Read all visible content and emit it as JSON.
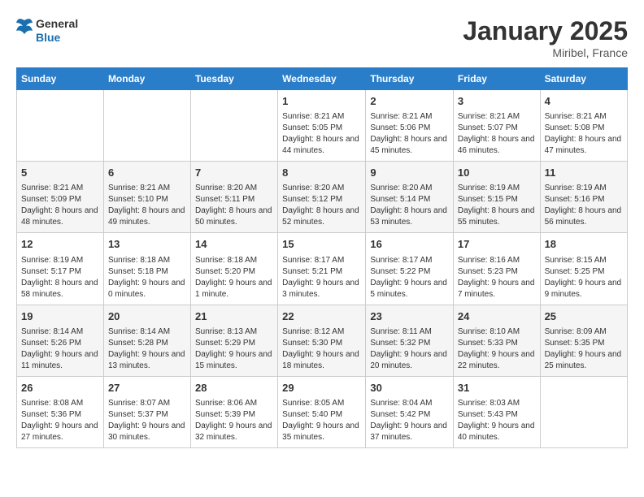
{
  "logo": {
    "line1": "General",
    "line2": "Blue"
  },
  "title": "January 2025",
  "location": "Miribel, France",
  "days_of_week": [
    "Sunday",
    "Monday",
    "Tuesday",
    "Wednesday",
    "Thursday",
    "Friday",
    "Saturday"
  ],
  "weeks": [
    [
      {
        "day": "",
        "sunrise": "",
        "sunset": "",
        "daylight": ""
      },
      {
        "day": "",
        "sunrise": "",
        "sunset": "",
        "daylight": ""
      },
      {
        "day": "",
        "sunrise": "",
        "sunset": "",
        "daylight": ""
      },
      {
        "day": "1",
        "sunrise": "Sunrise: 8:21 AM",
        "sunset": "Sunset: 5:05 PM",
        "daylight": "Daylight: 8 hours and 44 minutes."
      },
      {
        "day": "2",
        "sunrise": "Sunrise: 8:21 AM",
        "sunset": "Sunset: 5:06 PM",
        "daylight": "Daylight: 8 hours and 45 minutes."
      },
      {
        "day": "3",
        "sunrise": "Sunrise: 8:21 AM",
        "sunset": "Sunset: 5:07 PM",
        "daylight": "Daylight: 8 hours and 46 minutes."
      },
      {
        "day": "4",
        "sunrise": "Sunrise: 8:21 AM",
        "sunset": "Sunset: 5:08 PM",
        "daylight": "Daylight: 8 hours and 47 minutes."
      }
    ],
    [
      {
        "day": "5",
        "sunrise": "Sunrise: 8:21 AM",
        "sunset": "Sunset: 5:09 PM",
        "daylight": "Daylight: 8 hours and 48 minutes."
      },
      {
        "day": "6",
        "sunrise": "Sunrise: 8:21 AM",
        "sunset": "Sunset: 5:10 PM",
        "daylight": "Daylight: 8 hours and 49 minutes."
      },
      {
        "day": "7",
        "sunrise": "Sunrise: 8:20 AM",
        "sunset": "Sunset: 5:11 PM",
        "daylight": "Daylight: 8 hours and 50 minutes."
      },
      {
        "day": "8",
        "sunrise": "Sunrise: 8:20 AM",
        "sunset": "Sunset: 5:12 PM",
        "daylight": "Daylight: 8 hours and 52 minutes."
      },
      {
        "day": "9",
        "sunrise": "Sunrise: 8:20 AM",
        "sunset": "Sunset: 5:14 PM",
        "daylight": "Daylight: 8 hours and 53 minutes."
      },
      {
        "day": "10",
        "sunrise": "Sunrise: 8:19 AM",
        "sunset": "Sunset: 5:15 PM",
        "daylight": "Daylight: 8 hours and 55 minutes."
      },
      {
        "day": "11",
        "sunrise": "Sunrise: 8:19 AM",
        "sunset": "Sunset: 5:16 PM",
        "daylight": "Daylight: 8 hours and 56 minutes."
      }
    ],
    [
      {
        "day": "12",
        "sunrise": "Sunrise: 8:19 AM",
        "sunset": "Sunset: 5:17 PM",
        "daylight": "Daylight: 8 hours and 58 minutes."
      },
      {
        "day": "13",
        "sunrise": "Sunrise: 8:18 AM",
        "sunset": "Sunset: 5:18 PM",
        "daylight": "Daylight: 9 hours and 0 minutes."
      },
      {
        "day": "14",
        "sunrise": "Sunrise: 8:18 AM",
        "sunset": "Sunset: 5:20 PM",
        "daylight": "Daylight: 9 hours and 1 minute."
      },
      {
        "day": "15",
        "sunrise": "Sunrise: 8:17 AM",
        "sunset": "Sunset: 5:21 PM",
        "daylight": "Daylight: 9 hours and 3 minutes."
      },
      {
        "day": "16",
        "sunrise": "Sunrise: 8:17 AM",
        "sunset": "Sunset: 5:22 PM",
        "daylight": "Daylight: 9 hours and 5 minutes."
      },
      {
        "day": "17",
        "sunrise": "Sunrise: 8:16 AM",
        "sunset": "Sunset: 5:23 PM",
        "daylight": "Daylight: 9 hours and 7 minutes."
      },
      {
        "day": "18",
        "sunrise": "Sunrise: 8:15 AM",
        "sunset": "Sunset: 5:25 PM",
        "daylight": "Daylight: 9 hours and 9 minutes."
      }
    ],
    [
      {
        "day": "19",
        "sunrise": "Sunrise: 8:14 AM",
        "sunset": "Sunset: 5:26 PM",
        "daylight": "Daylight: 9 hours and 11 minutes."
      },
      {
        "day": "20",
        "sunrise": "Sunrise: 8:14 AM",
        "sunset": "Sunset: 5:28 PM",
        "daylight": "Daylight: 9 hours and 13 minutes."
      },
      {
        "day": "21",
        "sunrise": "Sunrise: 8:13 AM",
        "sunset": "Sunset: 5:29 PM",
        "daylight": "Daylight: 9 hours and 15 minutes."
      },
      {
        "day": "22",
        "sunrise": "Sunrise: 8:12 AM",
        "sunset": "Sunset: 5:30 PM",
        "daylight": "Daylight: 9 hours and 18 minutes."
      },
      {
        "day": "23",
        "sunrise": "Sunrise: 8:11 AM",
        "sunset": "Sunset: 5:32 PM",
        "daylight": "Daylight: 9 hours and 20 minutes."
      },
      {
        "day": "24",
        "sunrise": "Sunrise: 8:10 AM",
        "sunset": "Sunset: 5:33 PM",
        "daylight": "Daylight: 9 hours and 22 minutes."
      },
      {
        "day": "25",
        "sunrise": "Sunrise: 8:09 AM",
        "sunset": "Sunset: 5:35 PM",
        "daylight": "Daylight: 9 hours and 25 minutes."
      }
    ],
    [
      {
        "day": "26",
        "sunrise": "Sunrise: 8:08 AM",
        "sunset": "Sunset: 5:36 PM",
        "daylight": "Daylight: 9 hours and 27 minutes."
      },
      {
        "day": "27",
        "sunrise": "Sunrise: 8:07 AM",
        "sunset": "Sunset: 5:37 PM",
        "daylight": "Daylight: 9 hours and 30 minutes."
      },
      {
        "day": "28",
        "sunrise": "Sunrise: 8:06 AM",
        "sunset": "Sunset: 5:39 PM",
        "daylight": "Daylight: 9 hours and 32 minutes."
      },
      {
        "day": "29",
        "sunrise": "Sunrise: 8:05 AM",
        "sunset": "Sunset: 5:40 PM",
        "daylight": "Daylight: 9 hours and 35 minutes."
      },
      {
        "day": "30",
        "sunrise": "Sunrise: 8:04 AM",
        "sunset": "Sunset: 5:42 PM",
        "daylight": "Daylight: 9 hours and 37 minutes."
      },
      {
        "day": "31",
        "sunrise": "Sunrise: 8:03 AM",
        "sunset": "Sunset: 5:43 PM",
        "daylight": "Daylight: 9 hours and 40 minutes."
      },
      {
        "day": "",
        "sunrise": "",
        "sunset": "",
        "daylight": ""
      }
    ]
  ]
}
